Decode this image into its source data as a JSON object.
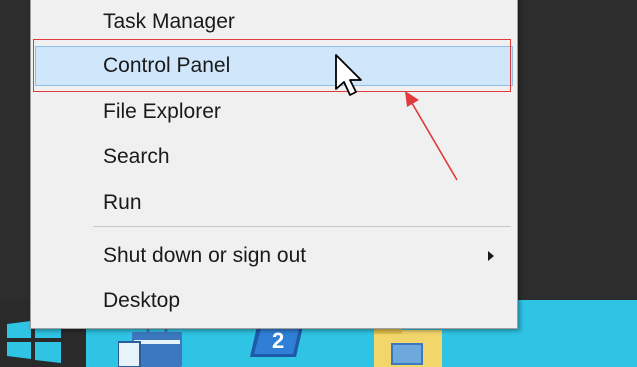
{
  "menu": {
    "items": [
      {
        "label": "Task Manager"
      },
      {
        "label": "Control Panel"
      },
      {
        "label": "File Explorer"
      },
      {
        "label": "Search"
      },
      {
        "label": "Run"
      },
      {
        "label": "Shut down or sign out"
      },
      {
        "label": "Desktop"
      }
    ],
    "highlighted_item": "Control Panel"
  },
  "taskbar": {
    "icons": [
      "windows-start-icon",
      "server-manager-icon",
      "powershell-icon",
      "file-explorer-icon"
    ]
  },
  "colors": {
    "taskbar": "#2fc4e4",
    "menu_background": "#f0f0f0",
    "highlight": "#cfe6fb",
    "annotation": "#e03a3a"
  }
}
